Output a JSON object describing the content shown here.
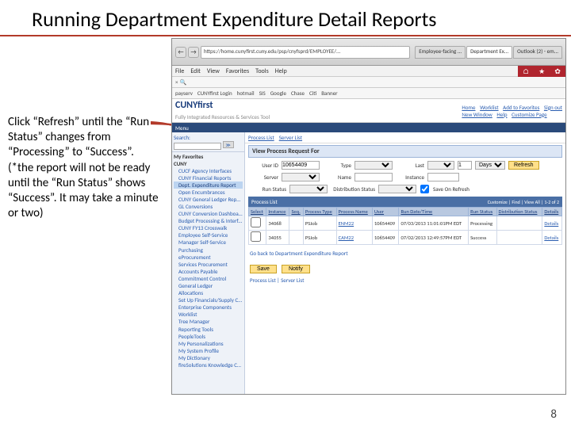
{
  "slide": {
    "title": "Running Department Expenditure Detail Reports",
    "number": "8"
  },
  "instruction": {
    "line1": "Click “Refresh” until the “Run Status” changes from “Processing” to “Success”.",
    "line2": "(*the report will not be ready until the “Run Status” shows “Success”. It may take a minute or two)"
  },
  "browser": {
    "url": "https://home.cunyfirst.cuny.edu/psp/cnyfsprd/EMPLOYEE/...",
    "tabs": [
      "Employee-facing ...",
      "Department Ex...",
      "Outlook (2) - em..."
    ],
    "active_tab": 1,
    "menubar": [
      "File",
      "Edit",
      "View",
      "Favorites",
      "Tools",
      "Help"
    ],
    "bookmarks": [
      "payserv",
      "CUNYfirst Login",
      "hotmail",
      "SIS",
      "Google",
      "Chase",
      "Citi",
      "Banner"
    ],
    "red_icons": [
      "⌂",
      "★",
      "⚙"
    ]
  },
  "cuny_header": {
    "logo": "CUNYfirst",
    "tagline": "Fully Integrated Resources & Services Tool",
    "links": [
      "Home",
      "Worklist",
      "Add to Favorites",
      "Sign out"
    ],
    "sublinks": [
      "New Window",
      "Help",
      "Customize Page"
    ]
  },
  "menu_label": "Menu",
  "sidebar": {
    "search_label": "Search:",
    "go_label": "≫",
    "header": "My Favorites",
    "group1": "CUNY",
    "items1": [
      "CUCF Agency Interfaces",
      "CUNY Financial Reports"
    ],
    "hl_item": "Dept. Expenditure Report",
    "items2": [
      "Open Encumbrances",
      "CUNY General Ledger Reports",
      "GL Conversions",
      "CUNY Conversion Dashboard",
      "Budget Processing & Interfaces",
      "CUNY FY13 Crosswalk",
      "Employee Self-Service",
      "Manager Self-Service",
      "Purchasing",
      "eProcurement",
      "Services Procurement",
      "Accounts Payable",
      "Commitment Control",
      "General Ledger",
      "Allocations",
      "Set Up Financials/Supply Chain",
      "Enterprise Components",
      "Worklist",
      "Tree Manager",
      "Reporting Tools",
      "PeopleTools",
      "My Personalizations",
      "My System Profile",
      "My Dictionary",
      "fireSolutions Knowledge Center"
    ]
  },
  "crumb": {
    "tab1": "Process List",
    "tab2": "Server List"
  },
  "panel": {
    "title": "View Process Request For"
  },
  "filters": {
    "user_label": "User ID",
    "user_val": "10654409",
    "type_label": "Type",
    "type_val": "",
    "last_label": "Last",
    "last_val": "1",
    "last_unit": "Days",
    "server_label": "Server",
    "name_label": "Name",
    "inst_label": "Instance",
    "runstatus_label": "Run Status",
    "dist_label": "Distribution Status",
    "save_label": "Save On Refresh",
    "refresh_label": "Refresh"
  },
  "process_list": {
    "title": "Process List",
    "controls": "Customize | Find | View All | 1-2 of 2",
    "cols": [
      "Select",
      "Instance",
      "Seq.",
      "Process Type",
      "Process Name",
      "User",
      "Run Date/Time",
      "Run Status",
      "Distribution Status",
      "Details"
    ],
    "rows": [
      {
        "sel": false,
        "instance": "34068",
        "seq": "",
        "ptype": "PSJob",
        "pname": "ENM22",
        "user": "10654409",
        "rdt": "07/03/2013 11:01:01PM EDT",
        "rstatus": "Processing",
        "dstatus": "",
        "details": "Details"
      },
      {
        "sel": false,
        "instance": "34055",
        "seq": "",
        "ptype": "PSJob",
        "pname": "CAM22",
        "user": "10654409",
        "rdt": "07/02/2013 12:49:57PM EDT",
        "rstatus": "Success",
        "dstatus": "",
        "details": "Details"
      }
    ]
  },
  "back_link": "Go back to Department Expenditure Report",
  "buttons": {
    "save": "Save",
    "notify": "Notify"
  },
  "small_links": "Process List | Server List"
}
